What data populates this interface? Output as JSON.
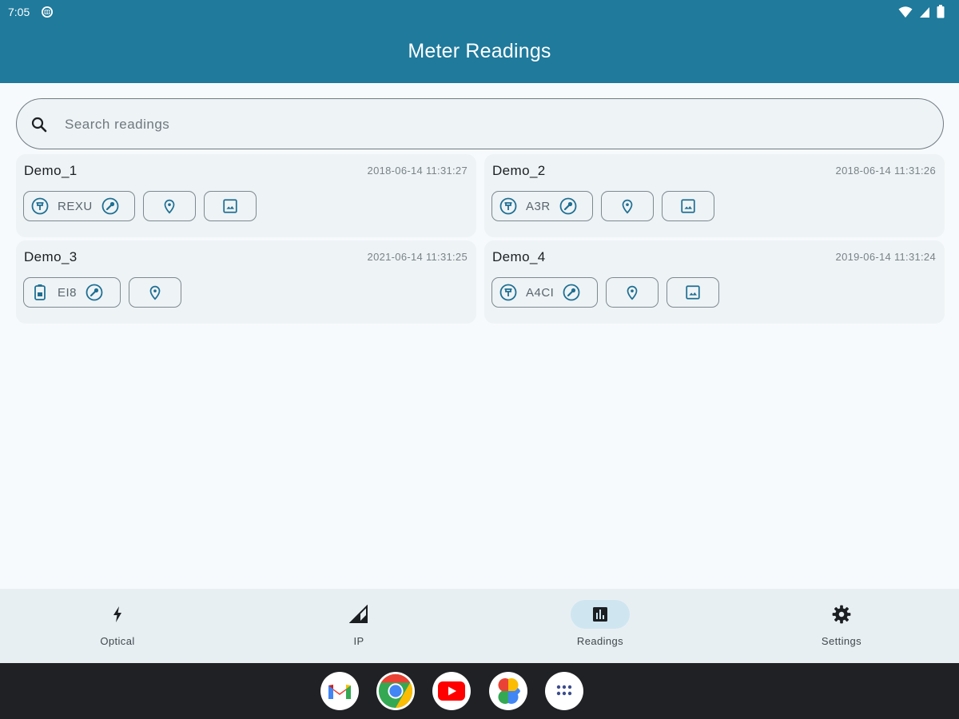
{
  "status_bar": {
    "time": "7:05"
  },
  "header": {
    "title": "Meter Readings"
  },
  "search": {
    "placeholder": "Search readings",
    "value": ""
  },
  "readings": [
    {
      "name": "Demo_1",
      "date": "2018-06-14 11:31:27",
      "meter_type": "meter-icon",
      "code": "REXU",
      "has_location": true,
      "has_image": true
    },
    {
      "name": "Demo_2",
      "date": "2018-06-14 11:31:26",
      "meter_type": "meter-icon",
      "code": "A3R",
      "has_location": true,
      "has_image": true
    },
    {
      "name": "Demo_3",
      "date": "2021-06-14 11:31:25",
      "meter_type": "battery-meter-icon",
      "code": "EI8",
      "has_location": true,
      "has_image": false
    },
    {
      "name": "Demo_4",
      "date": "2019-06-14 11:31:24",
      "meter_type": "meter-icon",
      "code": "A4CI",
      "has_location": true,
      "has_image": true
    }
  ],
  "bottom_nav": {
    "items": [
      {
        "label": "Optical",
        "icon": "bolt-icon",
        "active": false
      },
      {
        "label": "IP",
        "icon": "signal-icon",
        "active": false
      },
      {
        "label": "Readings",
        "icon": "bar-chart-icon",
        "active": true
      },
      {
        "label": "Settings",
        "icon": "gear-icon",
        "active": false
      }
    ]
  },
  "dock": {
    "apps": [
      "gmail-icon",
      "chrome-icon",
      "youtube-icon",
      "photos-icon",
      "app-drawer-icon"
    ]
  },
  "colors": {
    "primary": "#1f7a9c",
    "accent": "#1f6f92",
    "card": "#eef3f6",
    "background": "#f7fafc"
  }
}
